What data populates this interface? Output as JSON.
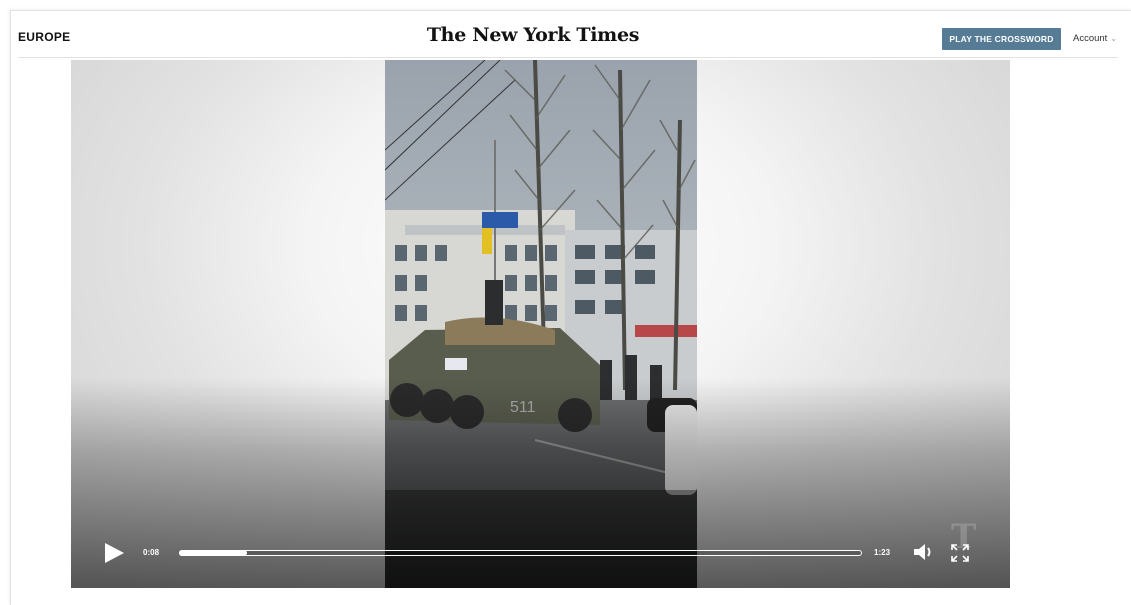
{
  "header": {
    "section_label": "EUROPE",
    "logo_text": "The New York Times",
    "cta_label": "PLAY THE CROSSWORD",
    "account_label": "Account",
    "account_icon": "chevron-down-icon"
  },
  "player": {
    "current_time": "0:08",
    "total_time": "1:23",
    "progress_fraction": 0.1,
    "play_icon": "play-icon",
    "volume_icon": "volume-icon",
    "fullscreen_icon": "fullscreen-icon"
  },
  "colors": {
    "cta_background": "#567b95",
    "text": "#121212"
  }
}
